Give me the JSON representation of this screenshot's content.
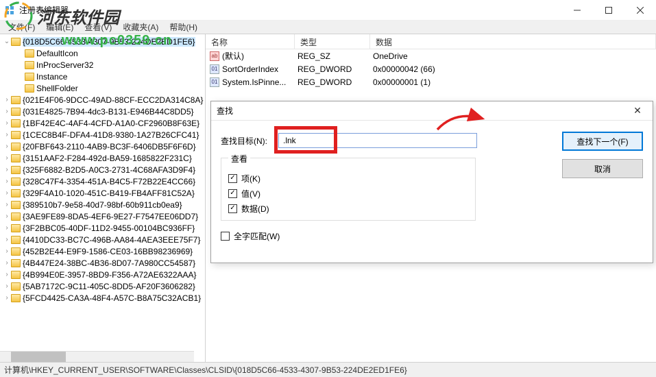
{
  "titlebar": {
    "title": "注册表编辑器"
  },
  "menu": {
    "file": "文件(F)",
    "edit": "编辑(E)",
    "view": "查看(V)",
    "favorites": "收藏夹(A)",
    "help": "帮助(H)"
  },
  "tree": {
    "selected": "{018D5C66-4533-4307-9B53-224DE2ED1FE6}",
    "children": [
      "DefaultIcon",
      "InProcServer32",
      "Instance",
      "ShellFolder"
    ],
    "siblings": [
      "{021E4F06-9DCC-49AD-88CF-ECC2DA314C8A}",
      "{031E4825-7B94-4dc3-B131-E946B44C8DD5}",
      "{1BF42E4C-4AF4-4CFD-A1A0-CF2960B8F63E}",
      "{1CEC8B4F-DFA4-41D8-9380-1A27B26CFC41}",
      "{20FBF643-2110-4AB9-BC3F-6406DB5F6F6D}",
      "{3151AAF2-F284-492d-BA59-1685822F231C}",
      "{325F6882-B2D5-A0C3-2731-4C68AFA3D9F4}",
      "{328C47F4-3354-451A-B4C5-F72B22E4CC66}",
      "{329F4A10-1020-451C-B419-FB4AFF81C52A}",
      "{389510b7-9e58-40d7-98bf-60b911cb0ea9}",
      "{3AE9FE89-8DA5-4EF6-9E27-F7547EE06DD7}",
      "{3F2BBC05-40DF-11D2-9455-00104BC936FF}",
      "{4410DC33-BC7C-496B-AA84-4AEA3EEE75F7}",
      "{452B2E44-E9F9-1586-CE03-16BB98236969}",
      "{4B447E24-38BC-4B36-8D07-7A980CC54587}",
      "{4B994E0E-3957-8BD9-F356-A72AE6322AAA}",
      "{5AB7172C-9C11-405C-8DD5-AF20F3606282}",
      "{5FCD4425-CA3A-48F4-A57C-B8A75C32ACB1}"
    ]
  },
  "list": {
    "header": {
      "name": "名称",
      "type": "类型",
      "data": "数据"
    },
    "rows": [
      {
        "icon": "ab",
        "name": "(默认)",
        "type": "REG_SZ",
        "data": "OneDrive"
      },
      {
        "icon": "01",
        "name": "SortOrderIndex",
        "type": "REG_DWORD",
        "data": "0x00000042 (66)"
      },
      {
        "icon": "01",
        "name": "System.IsPinne...",
        "type": "REG_DWORD",
        "data": "0x00000001 (1)"
      }
    ]
  },
  "find": {
    "title": "查找",
    "target_label": "查找目标(N):",
    "target_value": ".lnk",
    "look_legend": "查看",
    "chk_key": "项(K)",
    "chk_value": "值(V)",
    "chk_data": "数据(D)",
    "whole_match": "全字匹配(W)",
    "find_next": "查找下一个(F)",
    "cancel": "取消"
  },
  "statusbar": {
    "path": "计算机\\HKEY_CURRENT_USER\\SOFTWARE\\Classes\\CLSID\\{018D5C66-4533-4307-9B53-224DE2ED1FE6}"
  },
  "watermark": {
    "brand": "河东软件园",
    "url": "www.pc0359.cn"
  }
}
